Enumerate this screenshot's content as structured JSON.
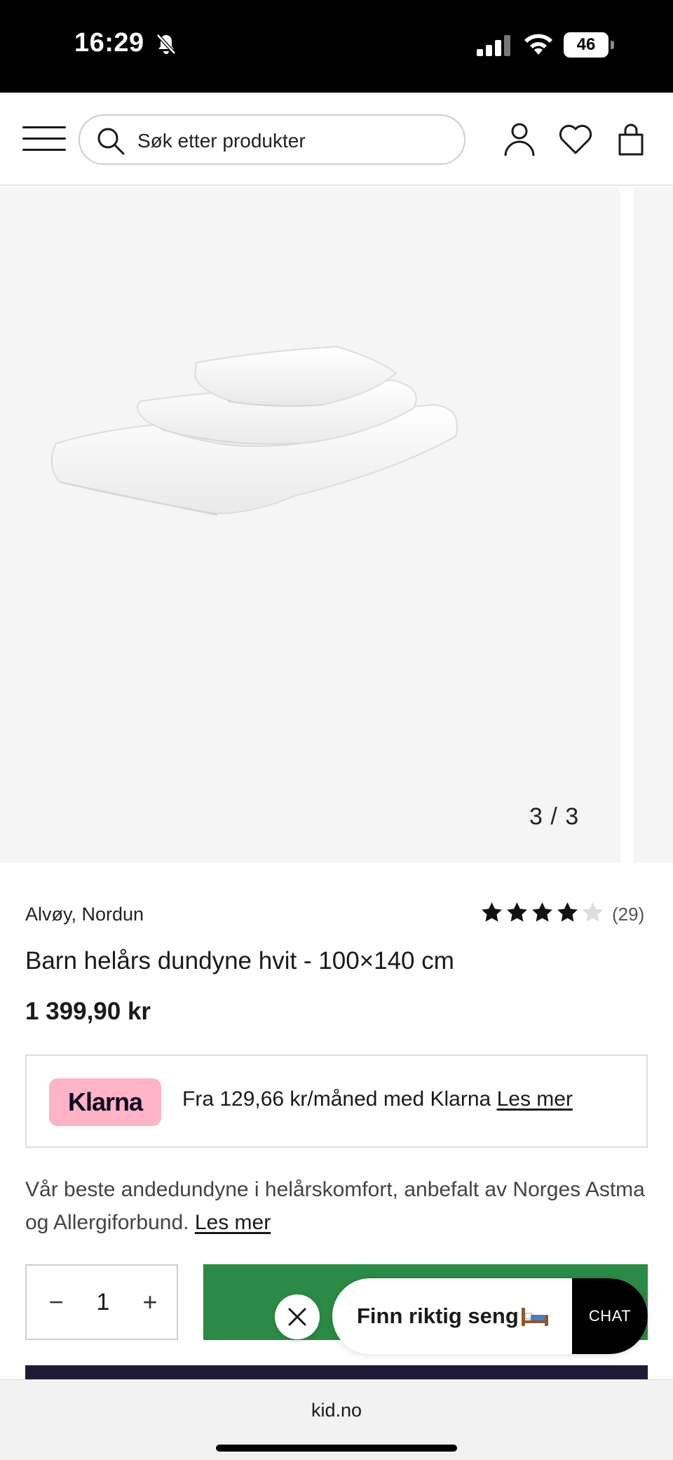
{
  "status_bar": {
    "time": "16:29",
    "battery": "46",
    "battery_level": 0.46
  },
  "header": {
    "search_placeholder": "Søk etter produkter"
  },
  "gallery": {
    "counter": "3 / 3"
  },
  "product": {
    "brand": "Alvøy, Nordun",
    "rating": 4,
    "rating_max": 5,
    "review_count": "(29)",
    "title": "Barn helårs dundyne hvit - 100×140 cm",
    "price": "1 399,90 kr"
  },
  "klarna": {
    "badge": "Klarna",
    "text": "Fra 129,66 kr/måned med Klarna",
    "link": "Les mer"
  },
  "description": {
    "text": "Vår beste andedundyne i helårskomfort, anbefalt av Norges Astma og Allergiforbund.",
    "link": "Les mer"
  },
  "quantity": {
    "minus": "−",
    "value": "1",
    "plus": "+"
  },
  "chat": {
    "label": "Finn riktig seng",
    "button": "CHAT"
  },
  "browser": {
    "url": "kid.no"
  },
  "colors": {
    "add_to_cart": "#2b8a45",
    "klarna_pink": "#ffb3c7",
    "dark_bar": "#1f1a35"
  }
}
